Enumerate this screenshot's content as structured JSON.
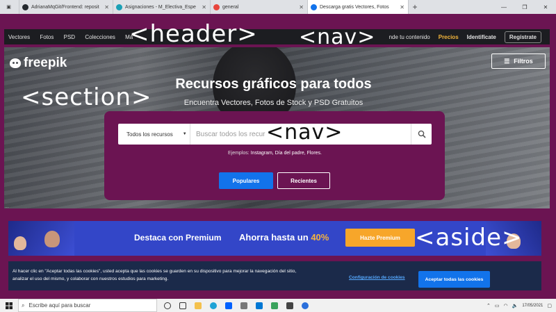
{
  "browser": {
    "tabs": [
      {
        "label": "AdrianaMqGit/Frontend: reposit",
        "icon": "github-icon",
        "color": "#24292e"
      },
      {
        "label": "Asignaciones - M_Electiva_Espe",
        "icon": "teams-icon",
        "color": "#1ba0b5"
      },
      {
        "label": "general",
        "icon": "teams-icon",
        "color": "#e8453c"
      },
      {
        "label": "Descarga gratis Vectores, Fotos",
        "icon": "freepik-icon",
        "color": "#1273eb"
      }
    ],
    "new_tab": "+"
  },
  "site_nav": {
    "left_items": [
      "Vectores",
      "Fotos",
      "PSD",
      "Colecciones",
      "Má"
    ],
    "sell": "nde tu contenido",
    "pricing": "Precios",
    "login": "Identifícate",
    "register": "Regístrate"
  },
  "hero": {
    "logo": "freepik",
    "filters": "Filtros",
    "title": "Recursos gráficos para todos",
    "subtitle": "Encuentra Vectores, Fotos de Stock y PSD Gratuitos",
    "search": {
      "category": "Todos los recursos",
      "placeholder": "Buscar todos los recur"
    },
    "examples_label": "Ejemplos:",
    "examples": "Instagram, Día del padre, Flores.",
    "popular": "Populares",
    "recent": "Recientes",
    "credit": "…"
  },
  "premium_banner": {
    "text": "Destaca con Premium",
    "save": "Ahorra hasta un",
    "percent": "40%",
    "cta": "Hazte Premium"
  },
  "cookies": {
    "message": "Al hacer clic en \"Aceptar todas las cookies\", usted acepta que las cookies se guarden en su dispositivo para mejorar la navegación del sitio, analizar el uso del mismo, y colaborar con nuestros estudios para marketing.",
    "config": "Configuración de cookies",
    "accept": "Aceptar todas las cookies"
  },
  "annotations": {
    "header": "<header>",
    "nav_top": "<nav>",
    "section": "<section>",
    "nav_search": "<nav>",
    "aside": "<aside>"
  },
  "taskbar": {
    "search_placeholder": "Escribe aquí para buscar",
    "date": "17/05/2021"
  }
}
